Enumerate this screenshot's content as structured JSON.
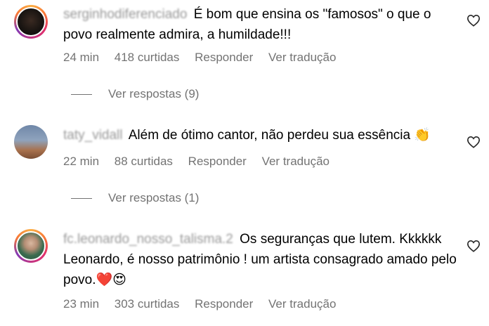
{
  "comments": [
    {
      "username": "serginhodiferenciado",
      "text": "É bom que ensina os \"famosos\" o que o povo realmente admira, a humildade!!!",
      "time": "24 min",
      "likes": "418 curtidas",
      "reply_label": "Responder",
      "translate_label": "Ver tradução",
      "view_replies": "Ver respostas (9)"
    },
    {
      "username": "taty_vidall",
      "text": "Além de ótimo cantor, não perdeu sua essência 👏",
      "time": "22 min",
      "likes": "88 curtidas",
      "reply_label": "Responder",
      "translate_label": "Ver tradução",
      "view_replies": "Ver respostas (1)"
    },
    {
      "username": "fc.leonardo_nosso_talisma.2",
      "text": "Os seguranças que lutem. Kkkkkk Leonardo, é nosso patrimônio ! um artista consagrado amado pelo povo.❤️😍",
      "time": "23 min",
      "likes": "303 curtidas",
      "reply_label": "Responder",
      "translate_label": "Ver tradução"
    }
  ],
  "colors": {
    "secondary_text": "#737373",
    "heart_stroke": "#262626"
  }
}
